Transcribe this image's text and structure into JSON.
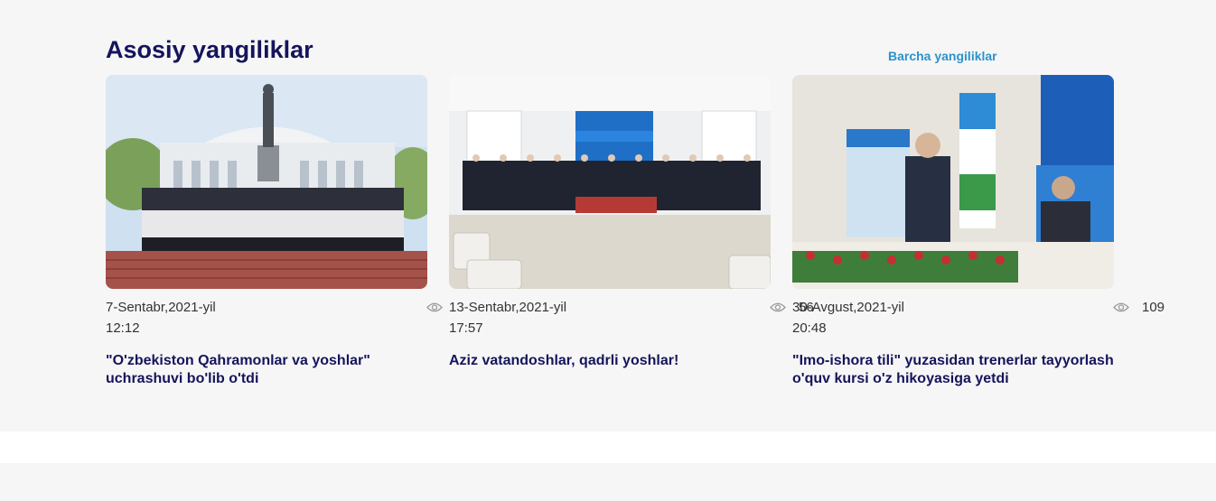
{
  "section": {
    "title": "Asosiy yangiliklar",
    "all_link": "Barcha yangiliklar"
  },
  "colors": {
    "title": "#15145c",
    "link": "#2a93cc",
    "background": "#f6f6f6"
  },
  "cards": [
    {
      "image_alt": "Students group photo at monument",
      "date": "7-Sentabr,2021-yil",
      "time": "12:12",
      "views": "",
      "title": "\"O'zbekiston Qahramonlar va yoshlar\" uchrashuvi bo'lib o'tdi"
    },
    {
      "image_alt": "Kelajak liderlari group photo",
      "date": "13-Sentabr,2021-yil",
      "time": "17:57",
      "views": "56",
      "title": "Aziz vatandoshlar, qadrli yoshlar!"
    },
    {
      "image_alt": "Speaker at conference podium",
      "date": "30-Avgust,2021-yil",
      "time": "20:48",
      "views": "109",
      "title": "\"Imo-ishora tili\" yuzasidan trenerlar tayyorlash o'quv kursi o'z hikoyasiga yetdi"
    }
  ],
  "icons": {
    "views": "eye-icon"
  }
}
